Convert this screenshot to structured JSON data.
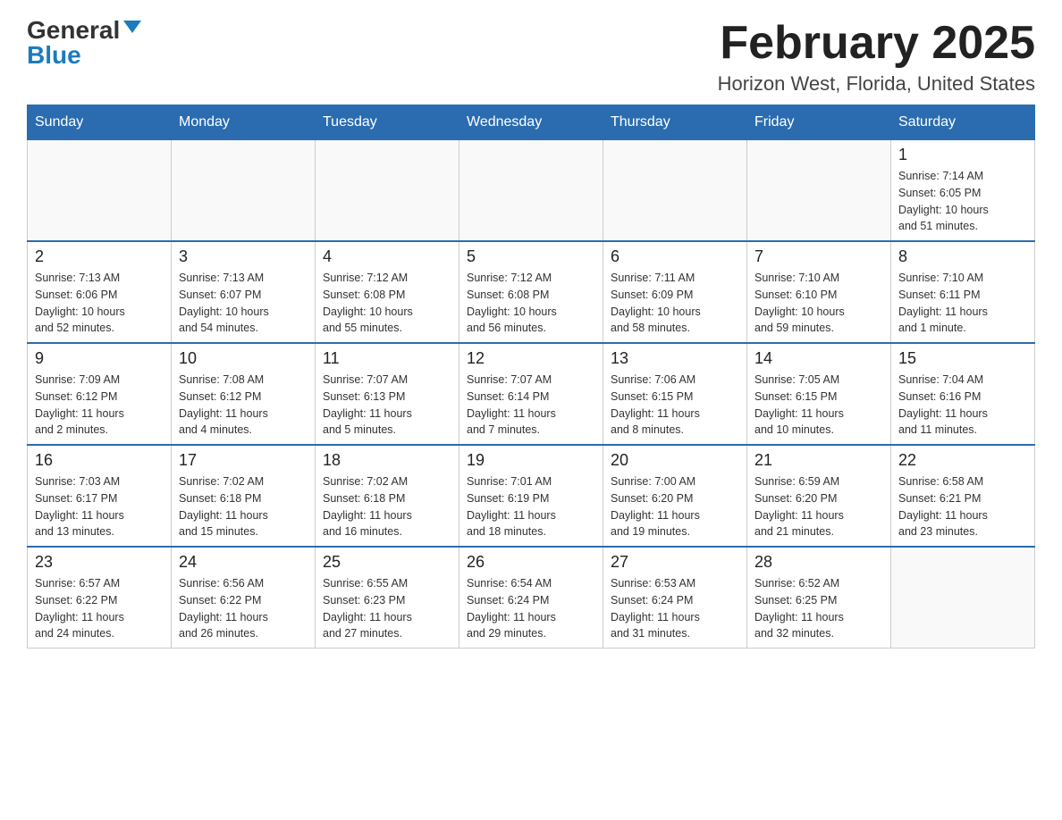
{
  "logo": {
    "general": "General",
    "blue": "Blue"
  },
  "title": "February 2025",
  "location": "Horizon West, Florida, United States",
  "days_of_week": [
    "Sunday",
    "Monday",
    "Tuesday",
    "Wednesday",
    "Thursday",
    "Friday",
    "Saturday"
  ],
  "weeks": [
    [
      {
        "day": "",
        "info": ""
      },
      {
        "day": "",
        "info": ""
      },
      {
        "day": "",
        "info": ""
      },
      {
        "day": "",
        "info": ""
      },
      {
        "day": "",
        "info": ""
      },
      {
        "day": "",
        "info": ""
      },
      {
        "day": "1",
        "info": "Sunrise: 7:14 AM\nSunset: 6:05 PM\nDaylight: 10 hours\nand 51 minutes."
      }
    ],
    [
      {
        "day": "2",
        "info": "Sunrise: 7:13 AM\nSunset: 6:06 PM\nDaylight: 10 hours\nand 52 minutes."
      },
      {
        "day": "3",
        "info": "Sunrise: 7:13 AM\nSunset: 6:07 PM\nDaylight: 10 hours\nand 54 minutes."
      },
      {
        "day": "4",
        "info": "Sunrise: 7:12 AM\nSunset: 6:08 PM\nDaylight: 10 hours\nand 55 minutes."
      },
      {
        "day": "5",
        "info": "Sunrise: 7:12 AM\nSunset: 6:08 PM\nDaylight: 10 hours\nand 56 minutes."
      },
      {
        "day": "6",
        "info": "Sunrise: 7:11 AM\nSunset: 6:09 PM\nDaylight: 10 hours\nand 58 minutes."
      },
      {
        "day": "7",
        "info": "Sunrise: 7:10 AM\nSunset: 6:10 PM\nDaylight: 10 hours\nand 59 minutes."
      },
      {
        "day": "8",
        "info": "Sunrise: 7:10 AM\nSunset: 6:11 PM\nDaylight: 11 hours\nand 1 minute."
      }
    ],
    [
      {
        "day": "9",
        "info": "Sunrise: 7:09 AM\nSunset: 6:12 PM\nDaylight: 11 hours\nand 2 minutes."
      },
      {
        "day": "10",
        "info": "Sunrise: 7:08 AM\nSunset: 6:12 PM\nDaylight: 11 hours\nand 4 minutes."
      },
      {
        "day": "11",
        "info": "Sunrise: 7:07 AM\nSunset: 6:13 PM\nDaylight: 11 hours\nand 5 minutes."
      },
      {
        "day": "12",
        "info": "Sunrise: 7:07 AM\nSunset: 6:14 PM\nDaylight: 11 hours\nand 7 minutes."
      },
      {
        "day": "13",
        "info": "Sunrise: 7:06 AM\nSunset: 6:15 PM\nDaylight: 11 hours\nand 8 minutes."
      },
      {
        "day": "14",
        "info": "Sunrise: 7:05 AM\nSunset: 6:15 PM\nDaylight: 11 hours\nand 10 minutes."
      },
      {
        "day": "15",
        "info": "Sunrise: 7:04 AM\nSunset: 6:16 PM\nDaylight: 11 hours\nand 11 minutes."
      }
    ],
    [
      {
        "day": "16",
        "info": "Sunrise: 7:03 AM\nSunset: 6:17 PM\nDaylight: 11 hours\nand 13 minutes."
      },
      {
        "day": "17",
        "info": "Sunrise: 7:02 AM\nSunset: 6:18 PM\nDaylight: 11 hours\nand 15 minutes."
      },
      {
        "day": "18",
        "info": "Sunrise: 7:02 AM\nSunset: 6:18 PM\nDaylight: 11 hours\nand 16 minutes."
      },
      {
        "day": "19",
        "info": "Sunrise: 7:01 AM\nSunset: 6:19 PM\nDaylight: 11 hours\nand 18 minutes."
      },
      {
        "day": "20",
        "info": "Sunrise: 7:00 AM\nSunset: 6:20 PM\nDaylight: 11 hours\nand 19 minutes."
      },
      {
        "day": "21",
        "info": "Sunrise: 6:59 AM\nSunset: 6:20 PM\nDaylight: 11 hours\nand 21 minutes."
      },
      {
        "day": "22",
        "info": "Sunrise: 6:58 AM\nSunset: 6:21 PM\nDaylight: 11 hours\nand 23 minutes."
      }
    ],
    [
      {
        "day": "23",
        "info": "Sunrise: 6:57 AM\nSunset: 6:22 PM\nDaylight: 11 hours\nand 24 minutes."
      },
      {
        "day": "24",
        "info": "Sunrise: 6:56 AM\nSunset: 6:22 PM\nDaylight: 11 hours\nand 26 minutes."
      },
      {
        "day": "25",
        "info": "Sunrise: 6:55 AM\nSunset: 6:23 PM\nDaylight: 11 hours\nand 27 minutes."
      },
      {
        "day": "26",
        "info": "Sunrise: 6:54 AM\nSunset: 6:24 PM\nDaylight: 11 hours\nand 29 minutes."
      },
      {
        "day": "27",
        "info": "Sunrise: 6:53 AM\nSunset: 6:24 PM\nDaylight: 11 hours\nand 31 minutes."
      },
      {
        "day": "28",
        "info": "Sunrise: 6:52 AM\nSunset: 6:25 PM\nDaylight: 11 hours\nand 32 minutes."
      },
      {
        "day": "",
        "info": ""
      }
    ]
  ]
}
